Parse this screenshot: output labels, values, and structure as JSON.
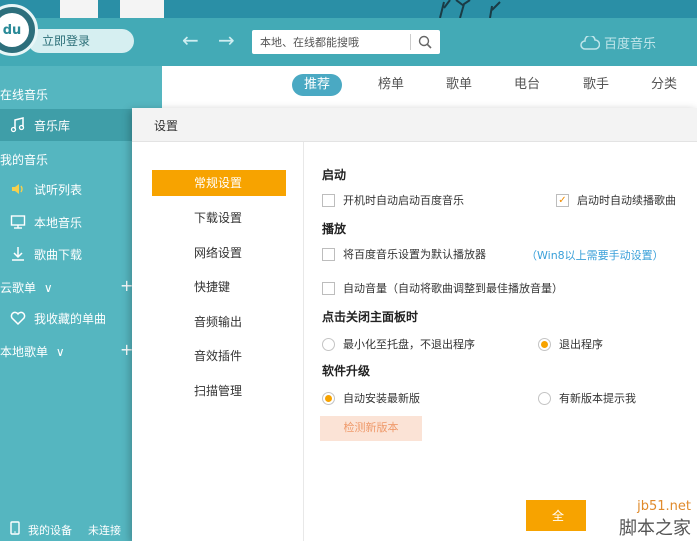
{
  "header": {
    "login_label": "立即登录",
    "search_placeholder": "本地、在线都能搜哦",
    "brand": "百度音乐",
    "logo_text": "du"
  },
  "sidebar": {
    "online_section": "在线音乐",
    "music_lib": "音乐库",
    "my_music_section": "我的音乐",
    "trial_list": "试听列表",
    "local_music": "本地音乐",
    "downloads": "歌曲下载",
    "cloud_playlists": "云歌单",
    "favorites": "我收藏的单曲",
    "local_playlists": "本地歌单",
    "my_device": "我的设备",
    "device_status": "未连接"
  },
  "tabs": [
    "推荐",
    "榜单",
    "歌单",
    "电台",
    "歌手",
    "分类"
  ],
  "dialog": {
    "title": "设置",
    "menu": [
      "常规设置",
      "下载设置",
      "网络设置",
      "快捷键",
      "音频输出",
      "音效插件",
      "扫描管理"
    ],
    "startup": {
      "title": "启动",
      "auto_start": "开机时自动启动百度音乐",
      "auto_resume": "启动时自动续播歌曲"
    },
    "playback": {
      "title": "播放",
      "default_player": "将百度音乐设置为默认播放器",
      "win8_note": "（Win8以上需要手动设置）",
      "auto_volume": "自动音量（自动将歌曲调整到最佳播放音量）"
    },
    "close_panel": {
      "title": "点击关闭主面板时",
      "minimize": "最小化至托盘，不退出程序",
      "exit": "退出程序"
    },
    "upgrade": {
      "title": "软件升级",
      "auto_install": "自动安装最新版",
      "notify": "有新版本提示我",
      "check_button": "检测新版本"
    },
    "ok_partial": "全"
  },
  "watermark": {
    "url": "jb51.net",
    "site": "脚本之家"
  },
  "colors": {
    "accent": "#f7a300",
    "sidebar": "#55b6c0",
    "header": "#43aab6",
    "tab_active": "#4aa9c3",
    "link": "#3aa0d9"
  }
}
